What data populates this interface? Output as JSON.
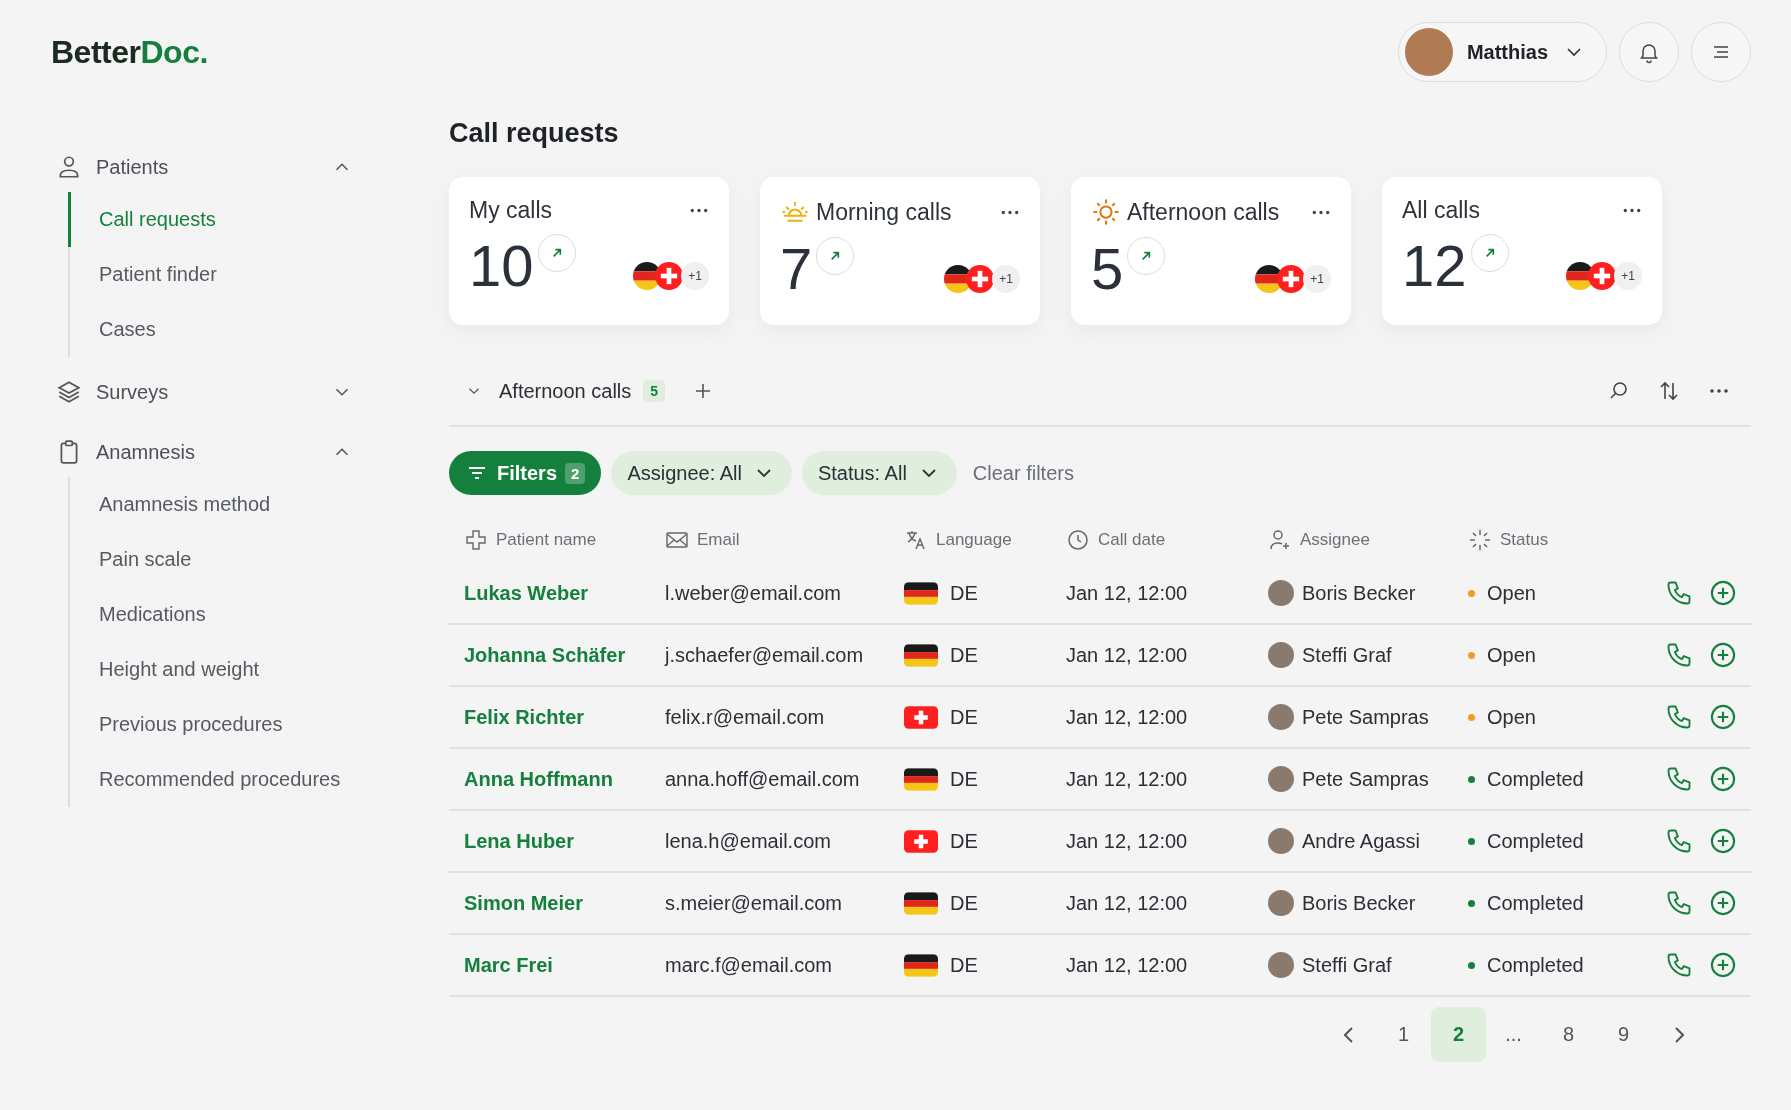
{
  "logo": {
    "dark": "Better",
    "accent": "Doc."
  },
  "user": {
    "name": "Matthias"
  },
  "sidebar": {
    "groups": [
      {
        "kind": "person",
        "label": "Patients",
        "expanded": true,
        "items": [
          {
            "label": "Call requests",
            "selected": true
          },
          {
            "label": "Patient finder",
            "selected": false
          },
          {
            "label": "Cases",
            "selected": false
          }
        ]
      },
      {
        "kind": "layers",
        "label": "Surveys",
        "expanded": false
      },
      {
        "kind": "clipboard",
        "label": "Anamnesis",
        "expanded": true,
        "items": [
          {
            "label": "Anamnesis method",
            "selected": false
          },
          {
            "label": "Pain scale",
            "selected": false
          },
          {
            "label": "Medications",
            "selected": false
          },
          {
            "label": "Height and weight",
            "selected": false
          },
          {
            "label": "Previous procedures",
            "selected": false
          },
          {
            "label": "Recommended procedures",
            "selected": false
          }
        ]
      }
    ]
  },
  "page_title": "Call requests",
  "cards": [
    {
      "kind": "plain",
      "title": "My calls",
      "count": "10",
      "flags": [
        {
          "kind": "de"
        },
        {
          "kind": "ch"
        }
      ],
      "more": "+1"
    },
    {
      "kind": "morning",
      "title": "Morning calls",
      "count": "7",
      "flags": [
        {
          "kind": "de"
        },
        {
          "kind": "ch"
        }
      ],
      "more": "+1"
    },
    {
      "kind": "afternoon",
      "title": "Afternoon calls",
      "count": "5",
      "flags": [
        {
          "kind": "de"
        },
        {
          "kind": "ch"
        }
      ],
      "more": "+1"
    },
    {
      "kind": "plain",
      "title": "All calls",
      "count": "12",
      "flags": [
        {
          "kind": "de"
        },
        {
          "kind": "ch"
        }
      ],
      "more": "+1"
    }
  ],
  "view": {
    "title": "Afternoon calls",
    "count": "5",
    "expanded": true
  },
  "filters": {
    "button": "Filters",
    "count": "2",
    "chips": [
      "Assignee: All",
      "Status: All"
    ],
    "clear": "Clear filters"
  },
  "table": {
    "columns": [
      {
        "kind": "patient",
        "label": "Patient name"
      },
      {
        "kind": "mail",
        "label": "Email"
      },
      {
        "kind": "lang",
        "label": "Language"
      },
      {
        "kind": "clock",
        "label": "Call date"
      },
      {
        "kind": "user",
        "label": "Assignee"
      },
      {
        "kind": "status",
        "label": "Status"
      }
    ],
    "rows": [
      {
        "name": "Lukas Weber",
        "email": "l.weber@email.com",
        "flag": {
          "kind": "de"
        },
        "language": "DE",
        "date": "Jan 12, 12:00",
        "assignee": "Boris Becker",
        "status": "Open",
        "color": "#f29d1f"
      },
      {
        "name": "Johanna Schäfer",
        "email": "j.schaefer@email.com",
        "flag": {
          "kind": "de"
        },
        "language": "DE",
        "date": "Jan 12, 12:00",
        "assignee": "Steffi Graf",
        "status": "Open",
        "color": "#f29d1f"
      },
      {
        "name": "Felix Richter",
        "email": "felix.r@email.com",
        "flag": {
          "kind": "ch"
        },
        "language": "DE",
        "date": "Jan 12, 12:00",
        "assignee": "Pete Sampras",
        "status": "Open",
        "color": "#f29d1f"
      },
      {
        "name": "Anna Hoffmann",
        "email": "anna.hoff@email.com",
        "flag": {
          "kind": "de"
        },
        "language": "DE",
        "date": "Jan 12, 12:00",
        "assignee": "Pete Sampras",
        "status": "Completed",
        "color": "#15803d"
      },
      {
        "name": "Lena Huber",
        "email": "lena.h@email.com",
        "flag": {
          "kind": "ch"
        },
        "language": "DE",
        "date": "Jan 12, 12:00",
        "assignee": "Andre Agassi",
        "status": "Completed",
        "color": "#15803d"
      },
      {
        "name": "Simon Meier",
        "email": "s.meier@email.com",
        "flag": {
          "kind": "de"
        },
        "language": "DE",
        "date": "Jan 12, 12:00",
        "assignee": "Boris Becker",
        "status": "Completed",
        "color": "#15803d"
      },
      {
        "name": "Marc Frei",
        "email": "marc.f@email.com",
        "flag": {
          "kind": "de"
        },
        "language": "DE",
        "date": "Jan 12, 12:00",
        "assignee": "Steffi Graf",
        "status": "Completed",
        "color": "#15803d"
      }
    ]
  },
  "pagination": [
    {
      "label": "1",
      "selected": false
    },
    {
      "label": "2",
      "selected": true
    },
    {
      "label": "...",
      "selected": false
    },
    {
      "label": "8",
      "selected": false
    },
    {
      "label": "9",
      "selected": false
    }
  ]
}
